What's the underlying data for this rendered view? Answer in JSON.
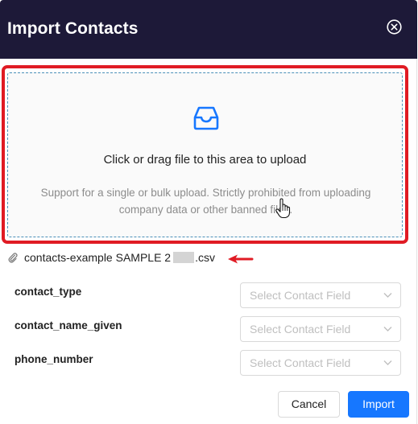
{
  "dialog": {
    "title": "Import Contacts",
    "close_icon": "close-circle-icon"
  },
  "upload": {
    "icon": "inbox-icon",
    "main_text": "Click or drag file to this area to upload",
    "hint_line1": "Support for a single or bulk upload. Strictly prohibited from uploading",
    "hint_line2": "company data or other banned files."
  },
  "file": {
    "icon": "paperclip-icon",
    "name_prefix": "contacts-example SAMPLE 2",
    "name_suffix": ".csv"
  },
  "fields": [
    {
      "label": "contact_type",
      "placeholder": "Select Contact Field"
    },
    {
      "label": "contact_name_given",
      "placeholder": "Select Contact Field"
    },
    {
      "label": "phone_number",
      "placeholder": "Select Contact Field"
    }
  ],
  "footer": {
    "cancel_label": "Cancel",
    "import_label": "Import"
  },
  "colors": {
    "header_bg": "#1d1938",
    "accent": "#1677ff",
    "annotation_red": "#e01b24"
  }
}
